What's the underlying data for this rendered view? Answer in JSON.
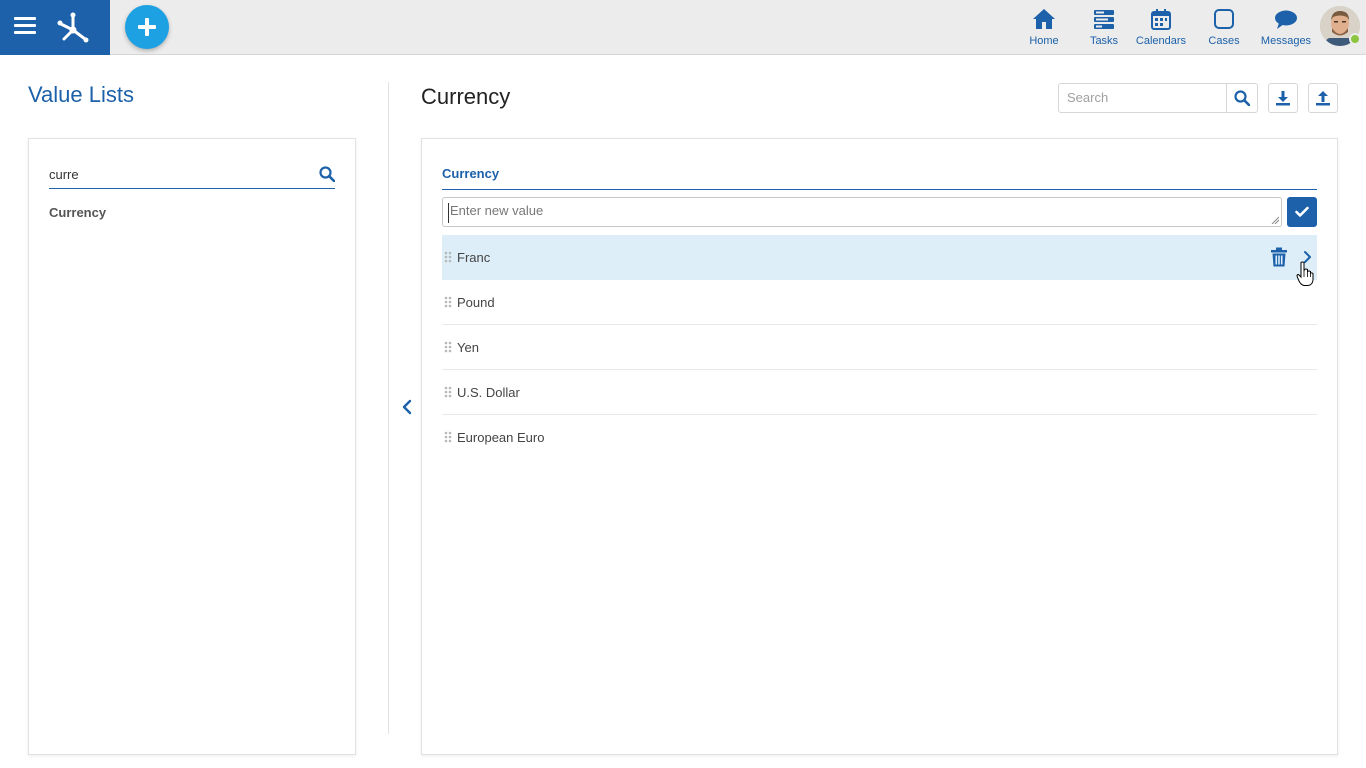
{
  "header": {
    "nav": [
      {
        "label": "Home",
        "icon": "home-icon"
      },
      {
        "label": "Tasks",
        "icon": "tasks-icon"
      },
      {
        "label": "Calendars",
        "icon": "calendar-icon"
      },
      {
        "label": "Cases",
        "icon": "cases-icon"
      },
      {
        "label": "Messages",
        "icon": "messages-icon"
      }
    ],
    "accent": "#1c61a9",
    "add_button_color": "#1da1e2",
    "status_color": "#8cc63f"
  },
  "left_panel": {
    "title": "Value Lists",
    "search_value": "curre",
    "results": [
      "Currency"
    ]
  },
  "right_panel": {
    "title": "Currency",
    "search_placeholder": "Search",
    "list_header": "Currency",
    "new_value_placeholder": "Enter new value",
    "items": [
      "Franc",
      "Pound",
      "Yen",
      "U.S. Dollar",
      "European Euro"
    ],
    "selected_item": "Franc"
  }
}
